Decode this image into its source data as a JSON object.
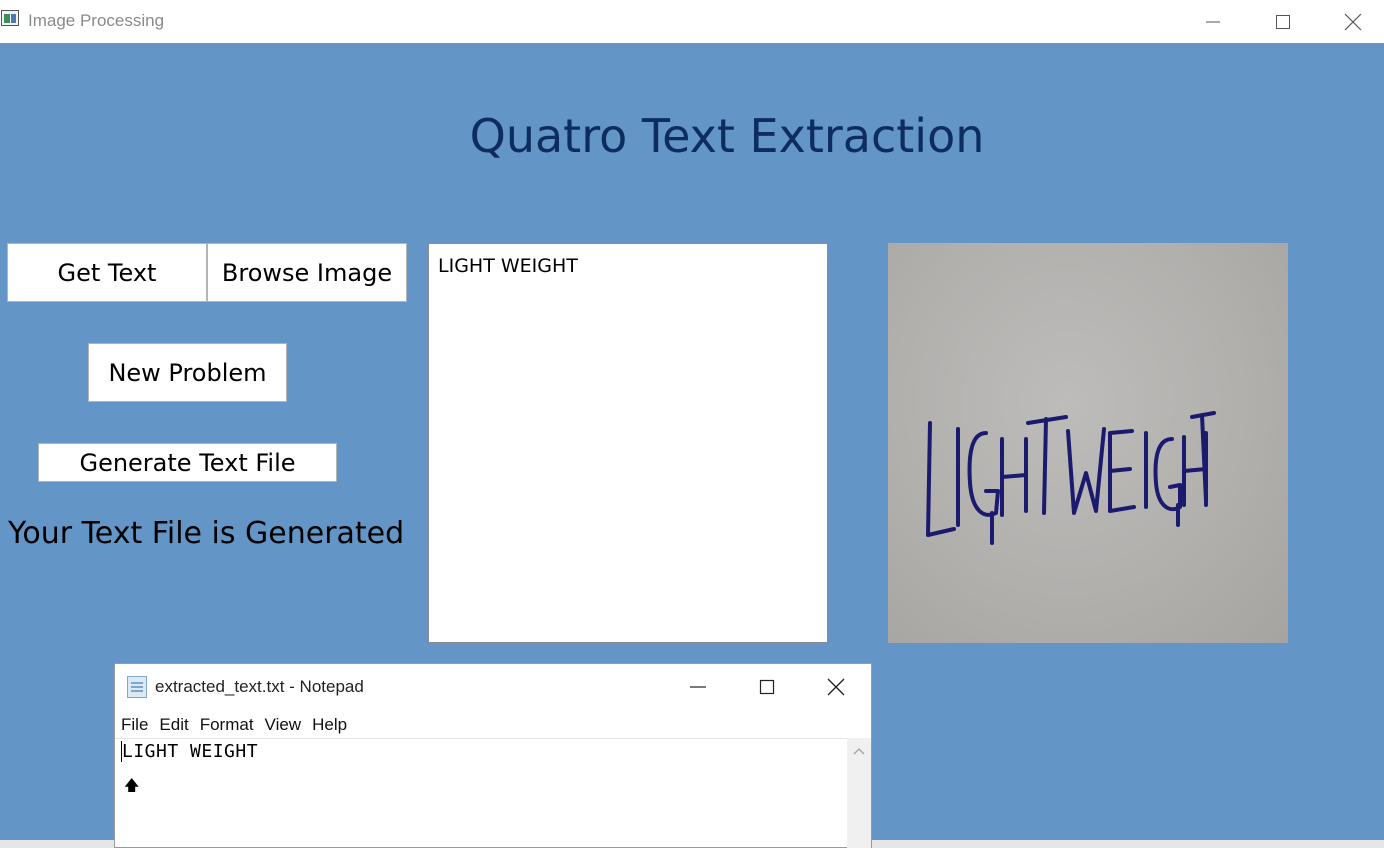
{
  "window": {
    "title": "Image Processing",
    "icons": {
      "app": "app-icon",
      "minimize": "minimize-icon",
      "maximize": "maximize-icon",
      "close": "close-icon"
    }
  },
  "main": {
    "heading": "Quatro Text Extraction",
    "buttons": {
      "get_text": "Get Text",
      "browse_image": "Browse Image",
      "new_problem": "New Problem",
      "generate_text_file": "Generate Text File"
    },
    "status": "Your Text File is Generated",
    "extracted_text": "LIGHT WEIGHT",
    "image_handwriting": "LIGHT WEIGHT"
  },
  "notepad": {
    "title": "extracted_text.txt - Notepad",
    "menu": [
      "File",
      "Edit",
      "Format",
      "View",
      "Help"
    ],
    "content": "LIGHT WEIGHT",
    "cursor_glyph": "🡅"
  },
  "colors": {
    "client_bg": "#6395c6",
    "heading": "#0c2d5e",
    "ink": "#1c1a6e"
  }
}
